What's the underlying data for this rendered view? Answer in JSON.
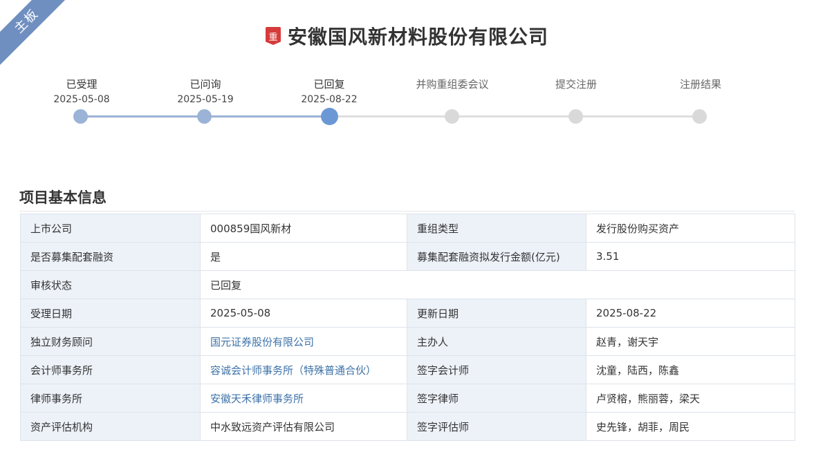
{
  "board_ribbon": "主板",
  "title_badge": "重",
  "company_title": "安徽国风新材料股份有限公司",
  "colors": {
    "ribbon": "#6f8fc0",
    "badge": "#d63b3b",
    "step_done": "#9bb3d6",
    "step_current": "#6b98d4",
    "step_pending": "#d9d9d9",
    "link": "#3d72a8",
    "key_bg": "#edf2f9"
  },
  "steps": [
    {
      "label": "已受理",
      "date": "2025-05-08",
      "status": "done"
    },
    {
      "label": "已问询",
      "date": "2025-05-19",
      "status": "done"
    },
    {
      "label": "已回复",
      "date": "2025-08-22",
      "status": "current"
    },
    {
      "label": "并购重组委会议",
      "date": "",
      "status": "pending"
    },
    {
      "label": "提交注册",
      "date": "",
      "status": "pending"
    },
    {
      "label": "注册结果",
      "date": "",
      "status": "pending"
    }
  ],
  "section_title": "项目基本信息",
  "info": {
    "listed_company_label": "上市公司",
    "listed_company_value": "000859国风新材",
    "restructure_type_label": "重组类型",
    "restructure_type_value": "发行股份购买资产",
    "supporting_financing_label": "是否募集配套融资",
    "supporting_financing_value": "是",
    "financing_amount_label": "募集配套融资拟发行金额(亿元)",
    "financing_amount_value": "3.51",
    "review_status_label": "审核状态",
    "review_status_value": "已回复",
    "accept_date_label": "受理日期",
    "accept_date_value": "2025-05-08",
    "update_date_label": "更新日期",
    "update_date_value": "2025-08-22",
    "advisor_label": "独立财务顾问",
    "advisor_value": "国元证券股份有限公司",
    "sponsor_label": "主办人",
    "sponsor_value": "赵青，谢天宇",
    "accounting_firm_label": "会计师事务所",
    "accounting_firm_value": "容诚会计师事务所（特殊普通合伙）",
    "signing_accountant_label": "签字会计师",
    "signing_accountant_value": "沈童，陆西，陈鑫",
    "law_firm_label": "律师事务所",
    "law_firm_value": "安徽天禾律师事务所",
    "signing_lawyer_label": "签字律师",
    "signing_lawyer_value": "卢贤榕，熊丽蓉，梁天",
    "appraisal_label": "资产评估机构",
    "appraisal_value": "中水致远资产评估有限公司",
    "signing_appraiser_label": "签字评估师",
    "signing_appraiser_value": "史先锋，胡菲，周民"
  }
}
